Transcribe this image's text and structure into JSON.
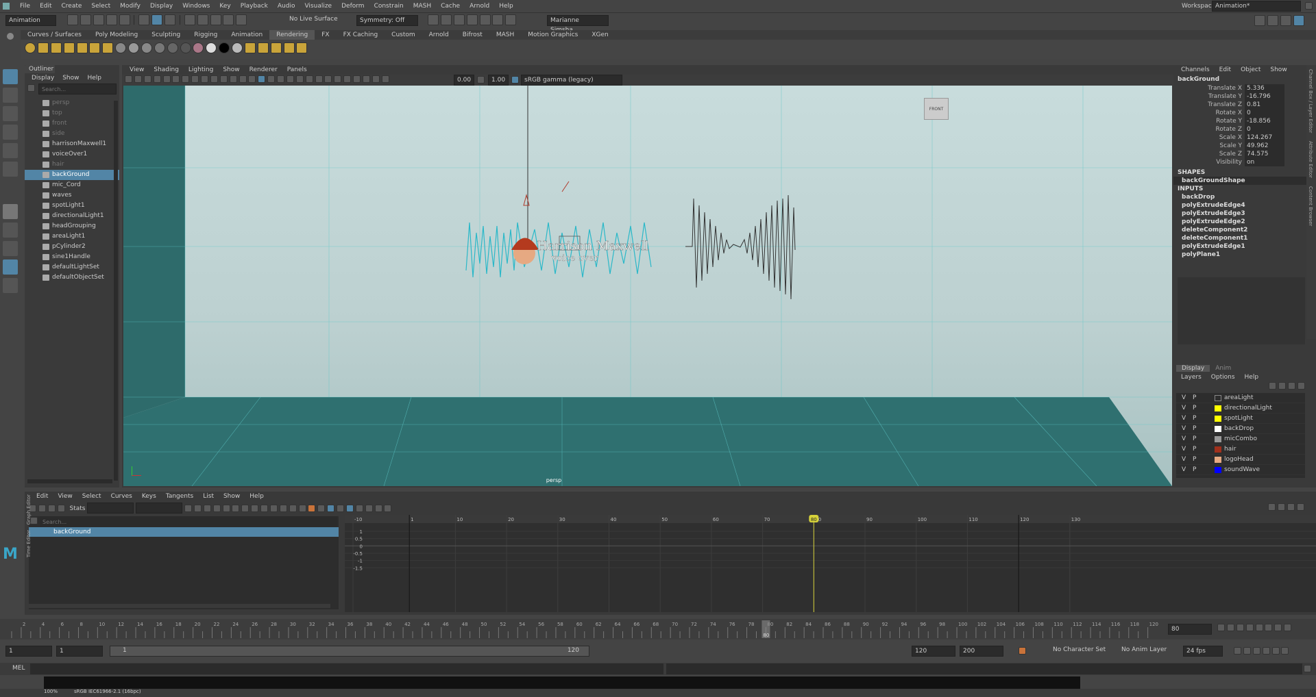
{
  "menubar": {
    "items": [
      "File",
      "Edit",
      "Create",
      "Select",
      "Modify",
      "Display",
      "Windows",
      "Key",
      "Playback",
      "Audio",
      "Visualize",
      "Deform",
      "Constrain",
      "MASH",
      "Cache",
      "Arnold",
      "Help"
    ],
    "workspace_label": "Workspace:",
    "workspace_value": "Animation*"
  },
  "statusline": {
    "mode": "Animation",
    "live_surface": "No Live Surface",
    "symmetry": "Symmetry: Off",
    "user": "Marianne Simsha..."
  },
  "shelf_tabs": [
    "Curves / Surfaces",
    "Poly Modeling",
    "Sculpting",
    "Rigging",
    "Animation",
    "Rendering",
    "FX",
    "FX Caching",
    "Custom",
    "Arnold",
    "Bifrost",
    "MASH",
    "Motion Graphics",
    "XGen"
  ],
  "shelf_active_tab": "Rendering",
  "outliner": {
    "title": "Outliner",
    "menu": [
      "Display",
      "Show",
      "Help"
    ],
    "search_placeholder": "Search...",
    "items": [
      {
        "label": "persp",
        "dim": true,
        "sel": false
      },
      {
        "label": "top",
        "dim": true,
        "sel": false
      },
      {
        "label": "front",
        "dim": true,
        "sel": false
      },
      {
        "label": "side",
        "dim": true,
        "sel": false
      },
      {
        "label": "harrisonMaxwell1",
        "dim": false,
        "sel": false
      },
      {
        "label": "voiceOver1",
        "dim": false,
        "sel": false
      },
      {
        "label": "hair",
        "dim": true,
        "sel": false
      },
      {
        "label": "backGround",
        "dim": false,
        "sel": true
      },
      {
        "label": "mic_Cord",
        "dim": false,
        "sel": false
      },
      {
        "label": "waves",
        "dim": false,
        "sel": false
      },
      {
        "label": "spotLight1",
        "dim": false,
        "sel": false
      },
      {
        "label": "directionalLight1",
        "dim": false,
        "sel": false
      },
      {
        "label": "headGrouping",
        "dim": false,
        "sel": false
      },
      {
        "label": "areaLight1",
        "dim": false,
        "sel": false
      },
      {
        "label": "pCylinder2",
        "dim": false,
        "sel": false
      },
      {
        "label": "sine1Handle",
        "dim": false,
        "sel": false
      },
      {
        "label": "defaultLightSet",
        "dim": false,
        "sel": false
      },
      {
        "label": "defaultObjectSet",
        "dim": false,
        "sel": false
      }
    ]
  },
  "viewport": {
    "menu": [
      "View",
      "Shading",
      "Lighting",
      "Show",
      "Renderer",
      "Panels"
    ],
    "exposure": "0.00",
    "gamma": "1.00",
    "colorspace": "sRGB gamma (legacy)",
    "camera_label": "persp",
    "viewcube_label": "FRONT",
    "title_text": "Harrison Maxwell",
    "subtitle_text": "voice over"
  },
  "channelbox": {
    "menu": [
      "Channels",
      "Edit",
      "Object",
      "Show"
    ],
    "object": "backGround",
    "attrs": [
      {
        "l": "Translate X",
        "v": "5.336"
      },
      {
        "l": "Translate Y",
        "v": "-16.796"
      },
      {
        "l": "Translate Z",
        "v": "0.81"
      },
      {
        "l": "Rotate X",
        "v": "0"
      },
      {
        "l": "Rotate Y",
        "v": "-18.856"
      },
      {
        "l": "Rotate Z",
        "v": "0"
      },
      {
        "l": "Scale X",
        "v": "124.267"
      },
      {
        "l": "Scale Y",
        "v": "49.962"
      },
      {
        "l": "Scale Z",
        "v": "74.575"
      },
      {
        "l": "Visibility",
        "v": "on"
      }
    ],
    "shapes_heading": "SHAPES",
    "shape": "backGroundShape",
    "inputs_heading": "INPUTS",
    "inputs": [
      "backDrop",
      "polyExtrudeEdge4",
      "polyExtrudeEdge3",
      "polyExtrudeEdge2",
      "deleteComponent2",
      "deleteComponent1",
      "polyExtrudeEdge1",
      "polyPlane1"
    ],
    "side_tabs": [
      "Channel Box / Layer Editor",
      "Attribute Editor",
      "Content Browser"
    ]
  },
  "layers": {
    "tabs": [
      "Display",
      "Anim"
    ],
    "menu": [
      "Layers",
      "Options",
      "Help"
    ],
    "rows": [
      {
        "name": "areaLight",
        "color": "none"
      },
      {
        "name": "directionalLight",
        "color": "#ffff00"
      },
      {
        "name": "spotLight",
        "color": "#ffff00"
      },
      {
        "name": "backDrop",
        "color": "#ffffff"
      },
      {
        "name": "micCombo",
        "color": "#999999"
      },
      {
        "name": "hair",
        "color": "#a0301c"
      },
      {
        "name": "logoHead",
        "color": "#e6a982"
      },
      {
        "name": "soundWave",
        "color": "#0000ff"
      }
    ],
    "v": "V",
    "p": "P"
  },
  "graph_editor": {
    "menu": [
      "Edit",
      "View",
      "Select",
      "Curves",
      "Keys",
      "Tangents",
      "List",
      "Show",
      "Help"
    ],
    "stats_label": "Stats",
    "search_placeholder": "Search...",
    "item": "backGround",
    "side_tabs": [
      "Graph Editor",
      "Time Editor"
    ],
    "ruler": [
      "-10",
      "1",
      "10",
      "20",
      "30",
      "40",
      "50",
      "60",
      "70",
      "80",
      "90",
      "100",
      "110",
      "120",
      "130"
    ],
    "y_ticks": [
      "1",
      "0.5",
      "0",
      "-0.5",
      "-1",
      "-1.5"
    ],
    "current_frame": "80",
    "end_marker": "120"
  },
  "timeslider": {
    "ticks": [
      "2",
      "4",
      "6",
      "8",
      "10",
      "12",
      "14",
      "16",
      "18",
      "20",
      "22",
      "24",
      "26",
      "28",
      "30",
      "32",
      "34",
      "36",
      "38",
      "40",
      "42",
      "44",
      "46",
      "48",
      "50",
      "52",
      "54",
      "56",
      "58",
      "60",
      "62",
      "64",
      "66",
      "68",
      "70",
      "72",
      "74",
      "76",
      "78",
      "80",
      "82",
      "84",
      "86",
      "88",
      "90",
      "92",
      "94",
      "96",
      "98",
      "100",
      "102",
      "104",
      "106",
      "108",
      "110",
      "112",
      "114",
      "116",
      "118",
      "120"
    ],
    "current": "80",
    "frame_field": "80"
  },
  "range": {
    "start": "1",
    "start2": "1",
    "range_start": "1",
    "range_end": "120",
    "end": "120",
    "end2": "200",
    "character_set": "No Character Set",
    "anim_layer": "No Anim Layer",
    "fps": "24 fps"
  },
  "cmdline": {
    "label": "MEL"
  },
  "helpline": {
    "zoom": "100%",
    "colorspace": "sRGB IEC61966-2.1 (16bpc)"
  }
}
